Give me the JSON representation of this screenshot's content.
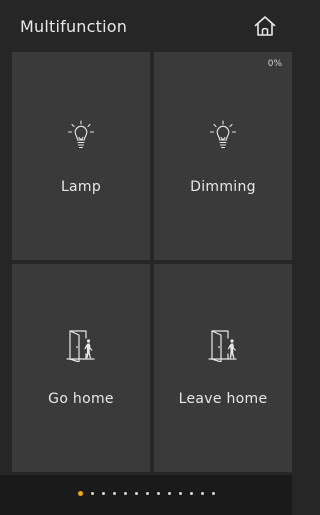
{
  "header": {
    "title": "Multifunction",
    "home_icon": "home-icon"
  },
  "tiles": [
    {
      "label": "Lamp",
      "icon": "lightbulb-icon"
    },
    {
      "label": "Dimming",
      "icon": "lightbulb-icon",
      "value": "0%"
    },
    {
      "label": "Go home",
      "icon": "door-enter-icon"
    },
    {
      "label": "Leave home",
      "icon": "door-exit-icon"
    }
  ],
  "pager": {
    "page_count": 13,
    "active_index": 0
  },
  "colors": {
    "background": "#262626",
    "tile": "#3a3a3a",
    "footer": "#1a1a1a",
    "text": "#e8e8e8",
    "active_dot": "#f0a800"
  }
}
